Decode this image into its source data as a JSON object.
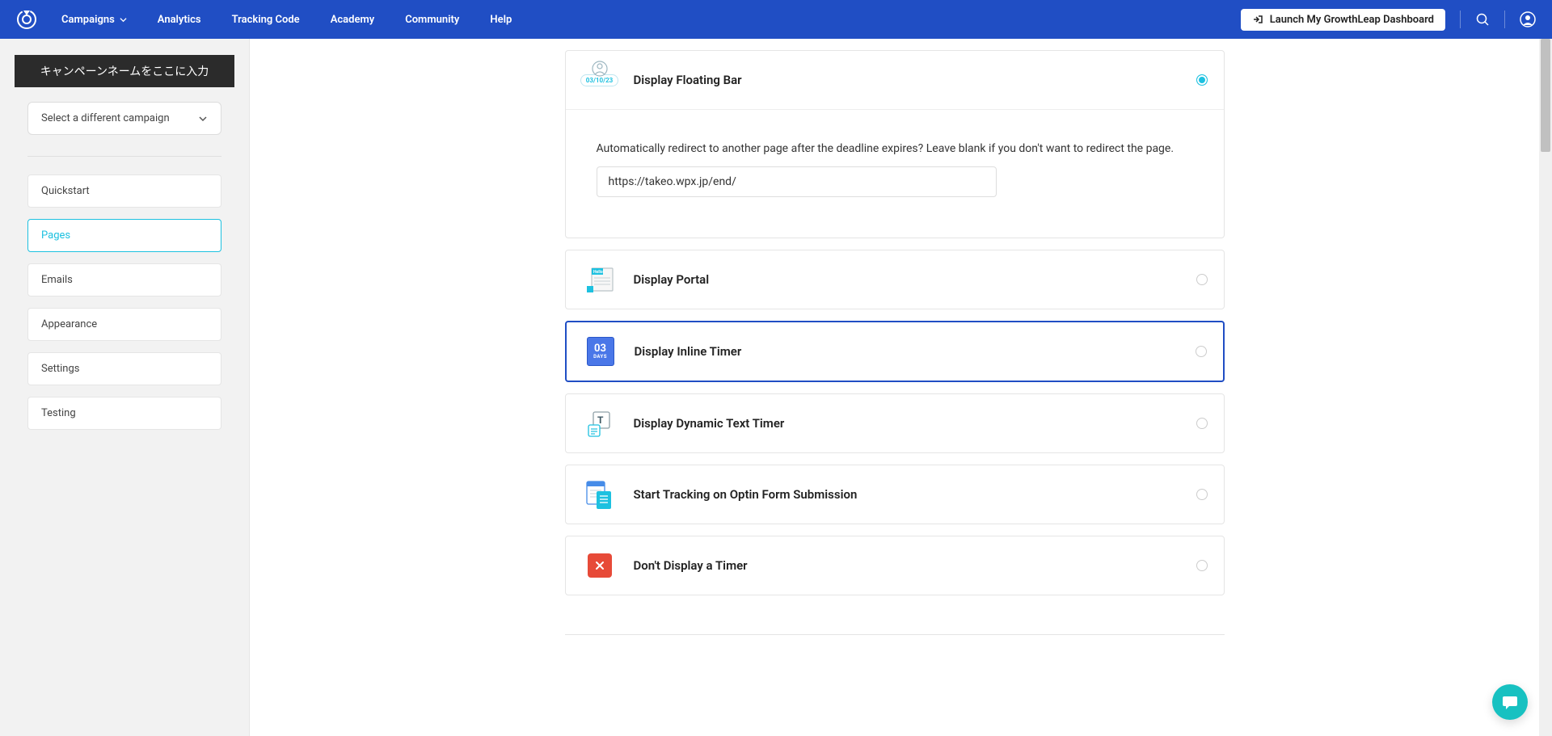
{
  "topnav": {
    "links": {
      "campaigns": "Campaigns",
      "analytics": "Analytics",
      "tracking": "Tracking Code",
      "academy": "Academy",
      "community": "Community",
      "help": "Help"
    },
    "launch_btn": "Launch My GrowthLeap Dashboard"
  },
  "sidebar": {
    "campaign_name_placeholder": "キャンペーンネームをここに入力",
    "campaign_select_label": "Select a different campaign",
    "items": {
      "quickstart": "Quickstart",
      "pages": "Pages",
      "emails": "Emails",
      "appearance": "Appearance",
      "settings": "Settings",
      "testing": "Testing"
    }
  },
  "main": {
    "options": {
      "floating_bar": {
        "title": "Display Floating Bar",
        "date": "03/10/23",
        "selected": true,
        "redirect_prompt": "Automatically redirect to another page after the deadline expires? Leave blank if you don't want to redirect the page.",
        "redirect_value": "https://takeo.wpx.jp/end/"
      },
      "portal": {
        "title": "Display Portal",
        "hello": "Hello!"
      },
      "inline_timer": {
        "title": "Display Inline Timer",
        "num": "03",
        "label": "DAYS"
      },
      "dynamic_text": {
        "title": "Display Dynamic Text Timer"
      },
      "tracking": {
        "title": "Start Tracking on Optin Form Submission"
      },
      "none": {
        "title": "Don't Display a Timer"
      }
    }
  }
}
